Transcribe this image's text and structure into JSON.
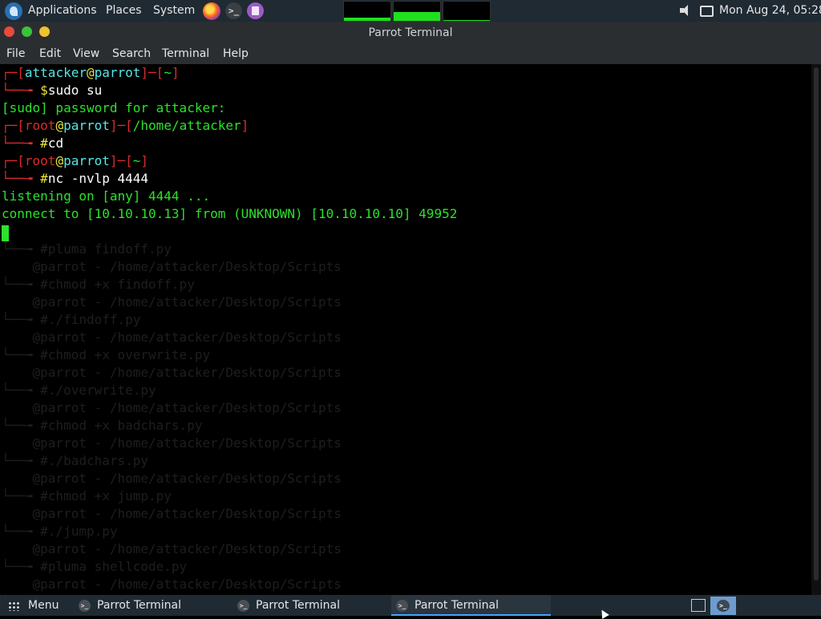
{
  "top_panel": {
    "applications": "Applications",
    "places": "Places",
    "system": "System",
    "clock": "Mon Aug 24, 05:28",
    "launchers": [
      "firefox-icon",
      "terminal-icon",
      "notes-icon"
    ],
    "monitors": [
      {
        "name": "cpu-monitor",
        "fill": 0.15
      },
      {
        "name": "memory-monitor",
        "fill": 0.45
      },
      {
        "name": "network-monitor",
        "fill": 0.05
      }
    ]
  },
  "window": {
    "title": "Parrot Terminal",
    "controls": {
      "close": "#e84a3c",
      "minimize": "#3ac43a",
      "maximize": "#f2c22e"
    }
  },
  "menubar": {
    "items": [
      "File",
      "Edit",
      "View",
      "Search",
      "Terminal",
      "Help"
    ]
  },
  "terminal": {
    "prompt1": {
      "bracket_open": "┌─[",
      "user": "attacker",
      "at": "@",
      "host": "parrot",
      "mid": "]─[",
      "path": "~",
      "bracket_close": "]"
    },
    "cmd1": {
      "prefix": "└──╼ ",
      "sigil": "$",
      "text": "sudo su"
    },
    "sudo_prompt": "[sudo] password for attacker:",
    "prompt2": {
      "bracket_open": "┌─[",
      "user": "root",
      "at": "@",
      "host": "parrot",
      "mid": "]─[",
      "path": "/home/attacker",
      "bracket_close": "]"
    },
    "cmd2": {
      "prefix": "└──╼ ",
      "sigil": "#",
      "text": "cd"
    },
    "prompt3": {
      "bracket_open": "┌─[",
      "user": "root",
      "at": "@",
      "host": "parrot",
      "mid": "]─[",
      "path": "~",
      "bracket_close": "]"
    },
    "cmd3": {
      "prefix": "└──╼ ",
      "sigil": "#",
      "text": "nc -nvlp 4444"
    },
    "output1": "listening on [any] 4444 ...",
    "output2": "connect to [10.10.10.13] from (UNKNOWN) [10.10.10.10] 49952",
    "ghost_lines": [
      "                                                                               ",
      "                                                                               ",
      "                                                                               ",
      "└──╼ #pluma findoff.py",
      "    @parrot - /home/attacker/Desktop/Scripts",
      "└──╼ #chmod +x findoff.py",
      "    @parrot - /home/attacker/Desktop/Scripts",
      "└──╼ #./findoff.py",
      "    @parrot - /home/attacker/Desktop/Scripts",
      "└──╼ #chmod +x overwrite.py",
      "    @parrot - /home/attacker/Desktop/Scripts",
      "└──╼ #./overwrite.py",
      "    @parrot - /home/attacker/Desktop/Scripts",
      "└──╼ #chmod +x badchars.py",
      "    @parrot - /home/attacker/Desktop/Scripts",
      "└──╼ #./badchars.py",
      "    @parrot - /home/attacker/Desktop/Scripts",
      "└──╼ #chmod +x jump.py",
      "    @parrot - /home/attacker/Desktop/Scripts",
      "└──╼ #./jump.py",
      "    @parrot - /home/attacker/Desktop/Scripts",
      "└──╼ #pluma shellcode.py",
      "    @parrot - /home/attacker/Desktop/Scripts",
      "└──╼ #"
    ],
    "colors": {
      "red": "#d92b2b",
      "cyan": "#55e6e6",
      "yellow": "#e8e337",
      "green": "#2be22b"
    }
  },
  "taskbar": {
    "menu_label": "Menu",
    "tasks": [
      {
        "label": "Parrot Terminal",
        "active": false
      },
      {
        "label": "Parrot Terminal",
        "active": false
      },
      {
        "label": "Parrot Terminal",
        "active": true
      }
    ]
  }
}
